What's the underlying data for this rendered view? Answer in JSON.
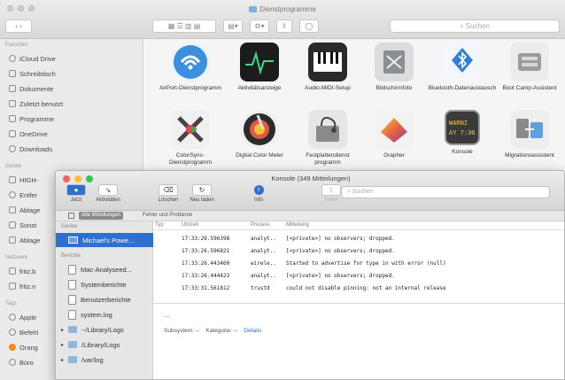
{
  "finder": {
    "title": "Dienstprogramme",
    "search_placeholder": "Suchen",
    "sidebar": {
      "favorites_header": "Favoriten",
      "favorites": [
        "iCloud Drive",
        "Schreibtisch",
        "Dokumente",
        "Zuletzt benutzt",
        "Programme",
        "OneDrive",
        "Downloads"
      ],
      "devices_header": "Geräte",
      "devices": [
        "HIGH-",
        "Entfer",
        "Ablage",
        "Sonst",
        "Ablage"
      ],
      "network_header": "Netzwerk",
      "network": [
        "fritz.b",
        "fritz.n"
      ],
      "tags_header": "Tags",
      "tags": [
        "Apple",
        "Befehl",
        "Orang",
        "Büro"
      ]
    },
    "apps": [
      {
        "label": "AirPort-Dienstprogramm",
        "icon": "airport-utility-icon",
        "color": "#3c8fe0"
      },
      {
        "label": "Aktivitätsanzeige",
        "icon": "activity-monitor-icon",
        "color": "#1c1c1c"
      },
      {
        "label": "Audio-MIDI-Setup",
        "icon": "audio-midi-icon",
        "color": "#2a2a2a"
      },
      {
        "label": "Bildschirmfoto",
        "icon": "screenshot-icon",
        "color": "#9a9a9a"
      },
      {
        "label": "Bluetooth-Datenaustausch",
        "icon": "bluetooth-icon",
        "color": "#2f7fd8"
      },
      {
        "label": "Boot Camp-Assistent",
        "icon": "bootcamp-icon",
        "color": "#9c9c9c"
      },
      {
        "label": "ColorSync-Dienstprogramm",
        "icon": "colorsync-icon",
        "color": "#555555"
      },
      {
        "label": "Digital Color Meter",
        "icon": "color-meter-icon",
        "color": "#2b2b2b"
      },
      {
        "label": "Festplattendienst programm",
        "icon": "disk-utility-icon",
        "color": "#8a8a8a"
      },
      {
        "label": "Grapher",
        "icon": "grapher-icon",
        "color": "#e0684a"
      },
      {
        "label": "Konsole",
        "icon": "console-icon",
        "color": "#2a2a2a"
      },
      {
        "label": "Migrationsassistent",
        "icon": "migration-icon",
        "color": "#8a8a8a"
      }
    ]
  },
  "console": {
    "title": "Konsole (349 Mitteilungen)",
    "tools": [
      "Jetzt",
      "Aktivitäten",
      "Löschen",
      "Neu laden",
      "Info",
      "Teilen"
    ],
    "search_placeholder": "Suchen",
    "filter": {
      "all_label": "Alle Mitteilungen",
      "errors_label": "Fehler und Probleme"
    },
    "sidebar": {
      "devices_header": "Geräte",
      "selected_device": "Michael's Powe...",
      "reports_header": "Berichte",
      "reports": [
        "Mac-Analyseed...",
        "Systemberichte",
        "Benutzerberichte",
        "system.log",
        "~/Library/Logs",
        "/Library/Logs",
        "/var/log"
      ]
    },
    "columns": {
      "type": "Typ",
      "time": "Uhrzeit",
      "process": "Prozess",
      "message": "Mitteilung"
    },
    "rows": [
      {
        "time": "17:33:26.596398",
        "process": "analyt..",
        "message": "[<private>] no observers; dropped."
      },
      {
        "time": "17:33:26.596821",
        "process": "analyt..",
        "message": "[<private>] no observers; dropped."
      },
      {
        "time": "17:33:26.443460",
        "process": "wirele..",
        "message": "Started to advertise for type in with error (null)"
      },
      {
        "time": "17:33:26.444423",
        "process": "analyt..",
        "message": "[<private>] no observers; dropped."
      },
      {
        "time": "17:33:31.561812",
        "process": "trustd",
        "message": "could not disable pinning: not an internal release"
      }
    ],
    "detail": {
      "subsystem": "Subsystem: --",
      "category": "Kategorie: --",
      "details_link": "Details"
    }
  }
}
